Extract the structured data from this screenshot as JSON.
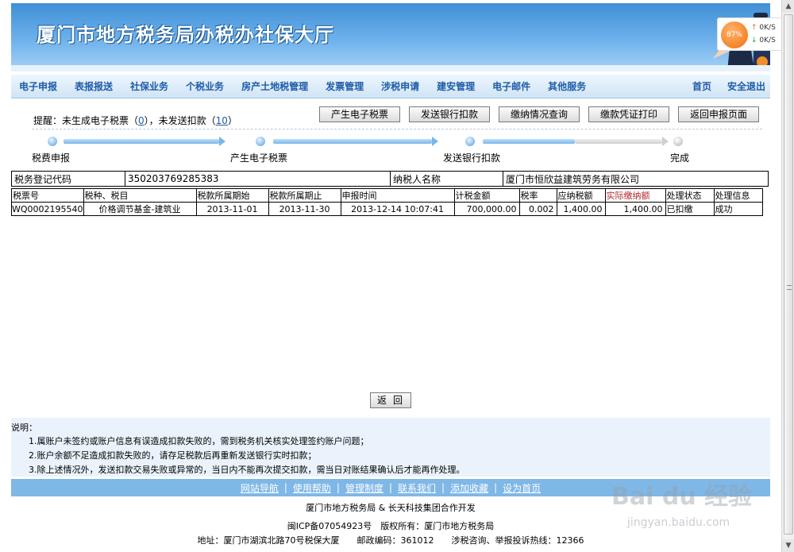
{
  "banner": {
    "title": "厦门市地方税务局办税办社保大厅"
  },
  "nav": {
    "items": [
      "电子申报",
      "表报报送",
      "社保业务",
      "个税业务",
      "房产土地税管理",
      "发票管理",
      "涉税申请",
      "建安管理",
      "电子邮件",
      "其他服务"
    ],
    "right": [
      "首页",
      "安全退出"
    ]
  },
  "notice": {
    "prefix": "提醒：未生成电子税票（",
    "count1": "0",
    "middle": "），未发送扣款（",
    "count2": "10",
    "suffix": "）"
  },
  "buttons": [
    "产生电子税票",
    "发送银行扣款",
    "缴纳情况查询",
    "缴款凭证打印",
    "返回申报页面"
  ],
  "steps": [
    "税费申报",
    "产生电子税票",
    "发送银行扣款",
    "完成"
  ],
  "info": {
    "label1": "税务登记代码",
    "value1": "350203769285383",
    "label2": "纳税人名称",
    "value2": "厦门市恒欣益建筑劳务有限公司"
  },
  "detail": {
    "headers": [
      "税票号",
      "税种、税目",
      "税款所属期始",
      "税款所属期止",
      "申报时间",
      "计税金额",
      "税率",
      "应纳税额",
      "实际缴纳额",
      "处理状态",
      "处理信息"
    ],
    "rows": [
      [
        "WQ0002195540",
        "价格调节基金-建筑业",
        "2013-11-01",
        "2013-11-30",
        "2013-12-14 10:07:41",
        "700,000.00",
        "0.002",
        "1,400.00",
        "1,400.00",
        "已扣缴",
        "成功"
      ]
    ]
  },
  "back_label": "返回",
  "notes": {
    "head": "说明：",
    "lines": [
      "1.属账户未签约或账户信息有误造成扣款失败的，需到税务机关核实处理签约账户问题；",
      "2.账户余额不足造成扣款失败的，请存足税款后再重新发送银行实时扣款；",
      "3.除上述情况外，发送扣款交易失败或异常的，当日内不能再次提交扣款，需当日对账结果确认后才能再作处理。"
    ]
  },
  "footer": {
    "links": [
      "网站导航",
      "使用帮助",
      "管理制度",
      "联系我们",
      "添加收藏",
      "设为首页"
    ],
    "line1": "厦门市地方税务局 & 长天科技集团合作开发",
    "line2": "闽ICP备07054923号　版权所有：厦门市地方税务局",
    "line3": "地址：厦门市湖滨北路70号税保大厦　　邮政编码：361012　　涉税咨询、举报投诉热线：12366"
  },
  "speed": {
    "percent": "87%",
    "up": "0K/S",
    "down": "0K/S"
  },
  "watermark": {
    "logo": "Bai du 经验",
    "url": "jingyan.baidu.com"
  }
}
